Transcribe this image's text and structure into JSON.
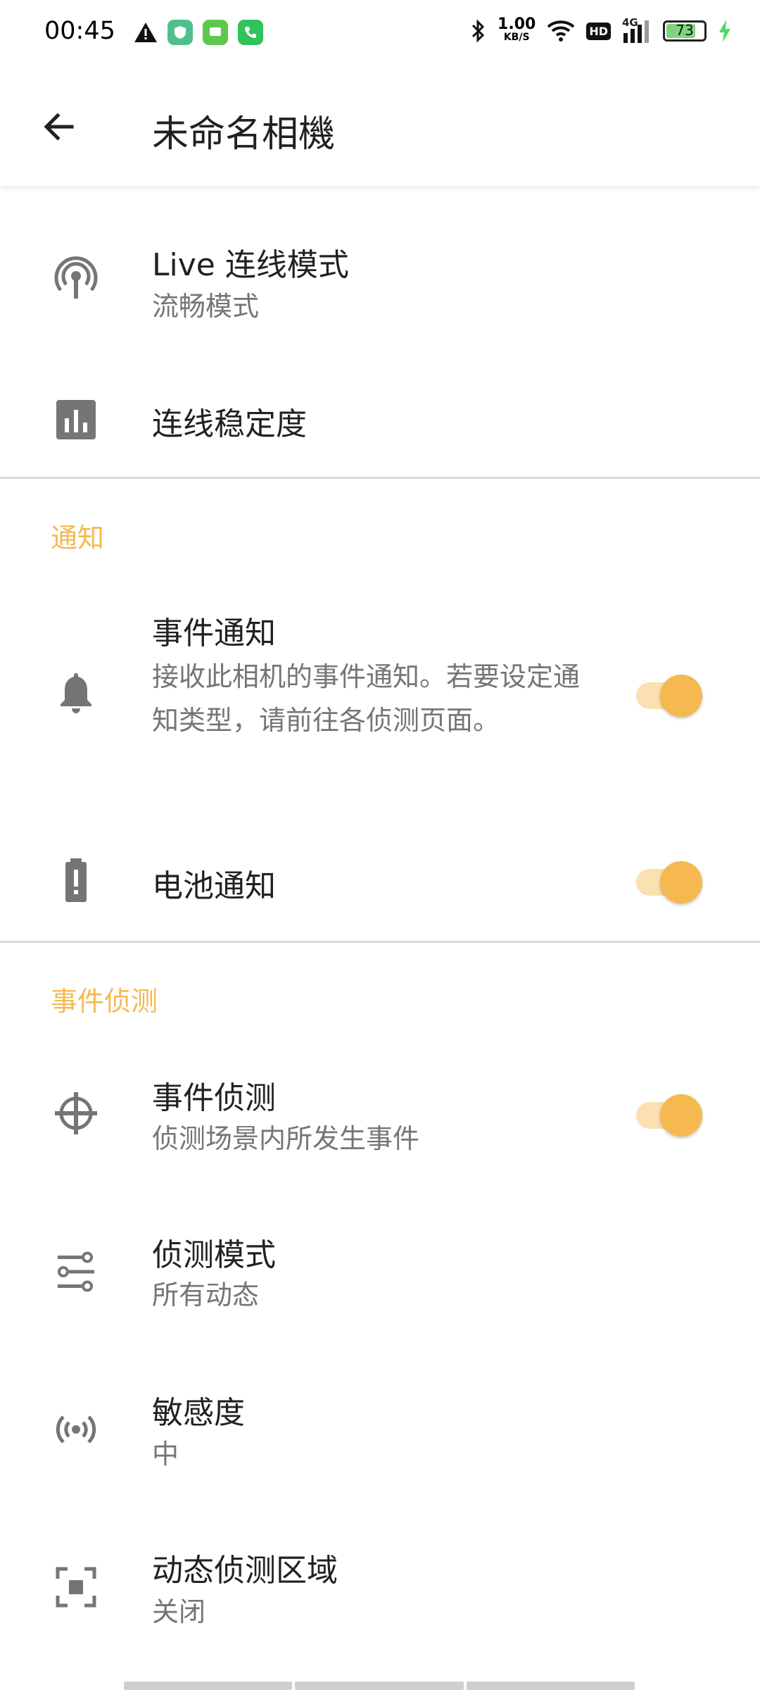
{
  "status_bar": {
    "time": "00:45",
    "speed_value": "1.00",
    "speed_unit": "KB/S",
    "hd_label": "HD",
    "network": "4G",
    "battery": "73",
    "icons": [
      "warning-icon",
      "app-icon-green",
      "messages-icon",
      "phone-icon",
      "bluetooth-icon",
      "wifi-icon",
      "signal-icon",
      "battery-icon",
      "charging-icon"
    ]
  },
  "header": {
    "title": "未命名相機",
    "back_icon": "arrow-left-icon"
  },
  "connection": {
    "live_mode": {
      "title": "Live 连线模式",
      "subtitle": "流畅模式",
      "icon": "antenna-icon"
    },
    "stability": {
      "title": "连线稳定度",
      "icon": "bar-chart-icon"
    }
  },
  "notifications": {
    "section_title": "通知",
    "event_notify": {
      "title": "事件通知",
      "subtitle": "接收此相机的事件通知。若要设定通知类型，请前往各侦测页面。",
      "enabled": true,
      "icon": "bell-icon"
    },
    "battery_notify": {
      "title": "电池通知",
      "enabled": true,
      "icon": "battery-alert-icon"
    }
  },
  "detection": {
    "section_title": "事件侦测",
    "event_detection": {
      "title": "事件侦测",
      "subtitle": "侦测场景内所发生事件",
      "enabled": true,
      "icon": "crosshair-icon"
    },
    "detection_mode": {
      "title": "侦测模式",
      "subtitle": "所有动态",
      "icon": "tune-icon"
    },
    "sensitivity": {
      "title": "敏感度",
      "subtitle": "中",
      "icon": "broadcast-icon"
    },
    "motion_zone": {
      "title": "动态侦测区域",
      "subtitle": "关闭",
      "icon": "focus-frame-icon"
    }
  },
  "colors": {
    "accent": "#f5b94f",
    "accent_track": "#fbe1b1",
    "text": "#212121",
    "secondary": "#757575"
  }
}
